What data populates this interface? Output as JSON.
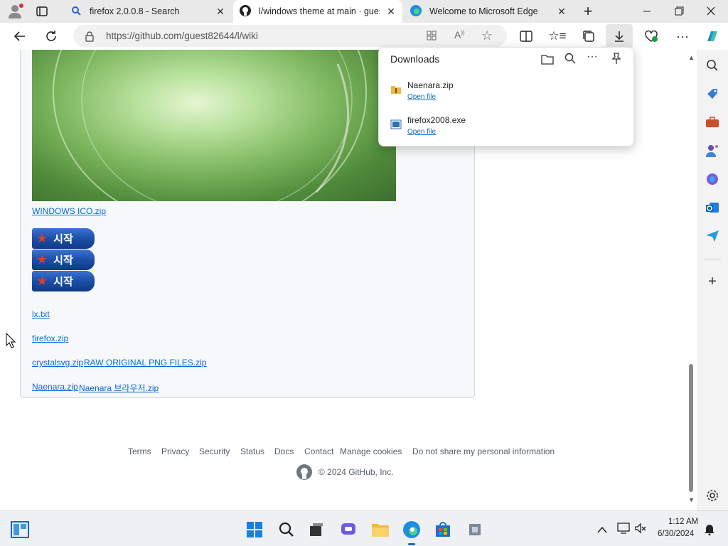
{
  "tabs": [
    {
      "title": "firefox 2.0.0.8 - Search",
      "icon": "search-icon"
    },
    {
      "title": "l/windows theme at main · guest",
      "icon": "github-icon",
      "active": true
    },
    {
      "title": "Welcome to Microsoft Edge",
      "icon": "edge-icon"
    }
  ],
  "address_bar": {
    "url": "https://github.com/guest82644/l/wiki"
  },
  "page": {
    "links": {
      "windows_ico": "WINDOWS ICO.zip",
      "lx_txt": "lx.txt",
      "firefox_zip": "firefox.zip",
      "crystalsvg": "crystalsvg.zip",
      "raw_png": "RAW ORIGINAL PNG FILES.zip",
      "naenara_zip": "Naenara.zip",
      "naenara_browser": "Naenara 브라우저.zip"
    },
    "start_buttons": [
      "시작",
      "시작",
      "시작"
    ]
  },
  "footer": {
    "links": [
      "Terms",
      "Privacy",
      "Security",
      "Status",
      "Docs",
      "Contact",
      "Manage cookies",
      "Do not share my personal information"
    ],
    "copyright": "© 2024 GitHub, Inc."
  },
  "downloads": {
    "title": "Downloads",
    "items": [
      {
        "name": "Naenara.zip",
        "action": "Open file",
        "icon": "zip-folder-icon"
      },
      {
        "name": "firefox2008.exe",
        "action": "Open file",
        "icon": "exe-file-icon"
      }
    ]
  },
  "taskbar": {
    "time": "1:12 AM",
    "date": "6/30/2024"
  },
  "colors": {
    "link": "#0969da",
    "edge_accent": "#0f6cbd"
  }
}
